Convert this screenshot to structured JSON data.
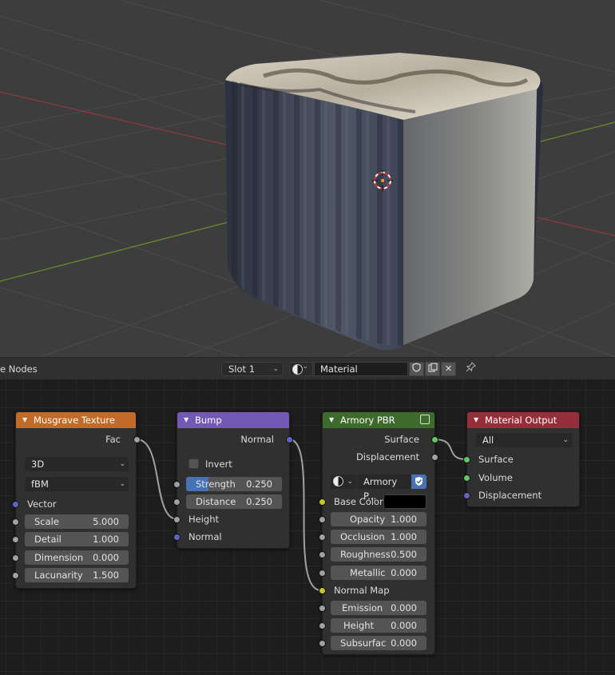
{
  "header": {
    "editor_title": "e Nodes",
    "slot": "Slot 1",
    "material": "Material",
    "icons": [
      "sphere-preview-icon",
      "fake-user-shield-icon",
      "duplicate-icon",
      "close-icon",
      "pin-icon"
    ]
  },
  "nodes": {
    "musgrave": {
      "title": "Musgrave Texture",
      "output": "Fac",
      "dimension": "3D",
      "type": "fBM",
      "vector": "Vector",
      "scale": {
        "label": "Scale",
        "value": "5.000"
      },
      "detail": {
        "label": "Detail",
        "value": "1.000"
      },
      "dimension_field": {
        "label": "Dimension",
        "value": "0.000"
      },
      "lacunarity": {
        "label": "Lacunarity",
        "value": "1.500"
      },
      "color": "#c26a28"
    },
    "bump": {
      "title": "Bump",
      "output": "Normal",
      "invert": "Invert",
      "strength": {
        "label": "Strength",
        "value": "0.250"
      },
      "distance": {
        "label": "Distance",
        "value": "0.250"
      },
      "height": "Height",
      "normal": "Normal",
      "color": "#7458b6"
    },
    "armory": {
      "title": "Armory PBR",
      "surface": "Surface",
      "displacement": "Displacement",
      "group_name": "Armory P...",
      "base_color": "Base Color",
      "opacity": {
        "label": "Opacity",
        "value": "1.000"
      },
      "occlusion": {
        "label": "Occlusion",
        "value": "1.000"
      },
      "roughness": {
        "label": "Roughness",
        "value": "0.500"
      },
      "metallic": {
        "label": "Metallic",
        "value": "0.000"
      },
      "normal_map": "Normal Map",
      "emission": {
        "label": "Emission",
        "value": "0.000"
      },
      "height": {
        "label": "Height",
        "value": "0.000"
      },
      "subsurface": {
        "label": "Subsurfac",
        "value": "0.000"
      },
      "color": "#3c6b2c"
    },
    "output": {
      "title": "Material Output",
      "target": "All",
      "surface": "Surface",
      "volume": "Volume",
      "displacement": "Displacement",
      "color": "#962e39"
    }
  }
}
